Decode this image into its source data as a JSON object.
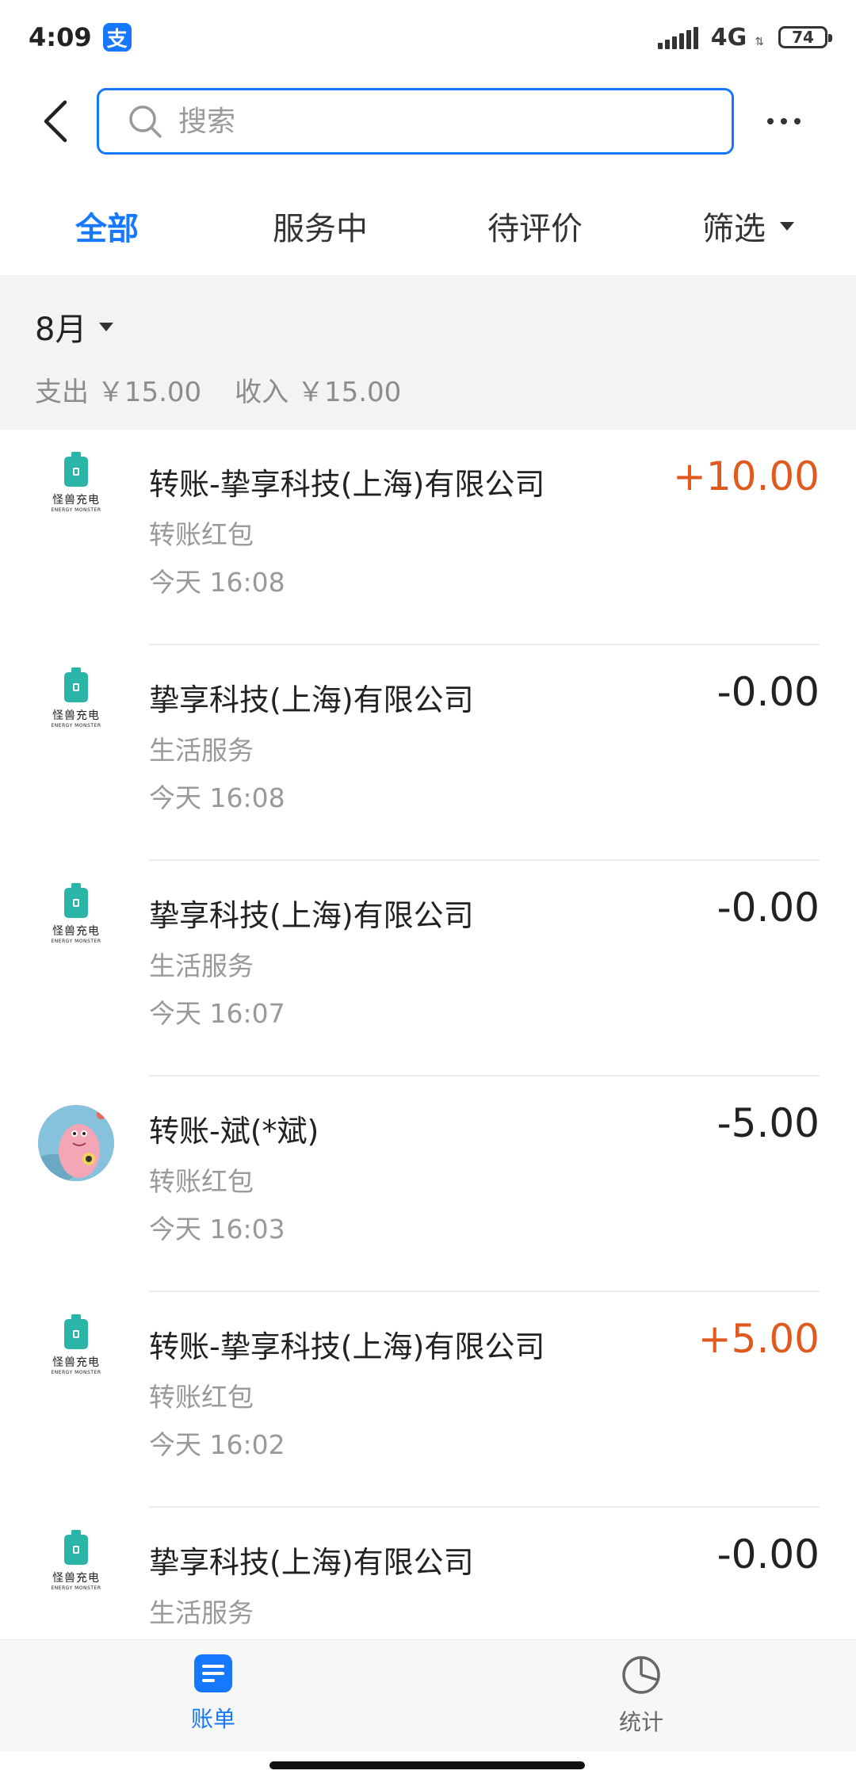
{
  "status_bar": {
    "time": "4:09",
    "app_badge": "支",
    "network": "4G",
    "battery": "74"
  },
  "search": {
    "placeholder": "搜索"
  },
  "tabs": [
    {
      "label": "全部",
      "active": true
    },
    {
      "label": "服务中",
      "active": false
    },
    {
      "label": "待评价",
      "active": false
    },
    {
      "label": "筛选",
      "active": false
    }
  ],
  "month": {
    "label": "8月",
    "expense": "支出 ￥15.00",
    "income": "收入 ￥15.00"
  },
  "bills": [
    {
      "title": "转账-挚享科技(上海)有限公司",
      "subtitle": "转账红包",
      "time": "今天  16:08",
      "amount": "+10.00",
      "icon": "energy-monster-logo"
    },
    {
      "title": "挚享科技(上海)有限公司",
      "subtitle": "生活服务",
      "time": "今天  16:08",
      "amount": "-0.00",
      "icon": "energy-monster-logo"
    },
    {
      "title": "挚享科技(上海)有限公司",
      "subtitle": "生活服务",
      "time": "今天  16:07",
      "amount": "-0.00",
      "icon": "energy-monster-logo"
    },
    {
      "title": "转账-斌(*斌)",
      "subtitle": "转账红包",
      "time": "今天  16:03",
      "amount": "-5.00",
      "icon": "user-avatar"
    },
    {
      "title": "转账-挚享科技(上海)有限公司",
      "subtitle": "转账红包",
      "time": "今天  16:02",
      "amount": "+5.00",
      "icon": "energy-monster-logo"
    },
    {
      "title": "挚享科技(上海)有限公司",
      "subtitle": "生活服务",
      "time": "",
      "amount": "-0.00",
      "icon": "energy-monster-logo"
    }
  ],
  "logo": {
    "text": "怪兽充电",
    "subtext": "ENERGY MONSTER"
  },
  "bottom_nav": {
    "bills_label": "账单",
    "stats_label": "统计"
  },
  "colors": {
    "accent": "#1677ff",
    "positive_amount": "#e05a1f",
    "logo_teal": "#2bb5a9"
  }
}
